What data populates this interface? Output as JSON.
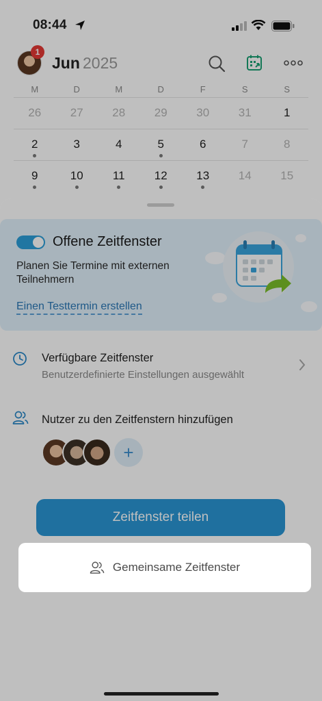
{
  "status_bar": {
    "time": "08:44"
  },
  "calendar": {
    "month": "Jun",
    "year": "2025",
    "notification_count": "1",
    "weekdays": [
      "M",
      "D",
      "M",
      "D",
      "F",
      "S",
      "S"
    ],
    "weeks": [
      [
        {
          "d": "26",
          "m": true,
          "e": false
        },
        {
          "d": "27",
          "m": true,
          "e": false
        },
        {
          "d": "28",
          "m": true,
          "e": false
        },
        {
          "d": "29",
          "m": true,
          "e": false
        },
        {
          "d": "30",
          "m": true,
          "e": false
        },
        {
          "d": "31",
          "m": true,
          "e": false
        },
        {
          "d": "1",
          "m": false,
          "e": false
        }
      ],
      [
        {
          "d": "2",
          "m": false,
          "e": true
        },
        {
          "d": "3",
          "m": false,
          "e": false
        },
        {
          "d": "4",
          "m": false,
          "e": false
        },
        {
          "d": "5",
          "m": false,
          "e": true
        },
        {
          "d": "6",
          "m": false,
          "e": false
        },
        {
          "d": "7",
          "m": true,
          "e": false
        },
        {
          "d": "8",
          "m": true,
          "e": false
        }
      ],
      [
        {
          "d": "9",
          "m": false,
          "e": true
        },
        {
          "d": "10",
          "m": false,
          "e": true
        },
        {
          "d": "11",
          "m": false,
          "e": true
        },
        {
          "d": "12",
          "m": false,
          "e": true
        },
        {
          "d": "13",
          "m": false,
          "e": true
        },
        {
          "d": "14",
          "m": true,
          "e": false
        },
        {
          "d": "15",
          "m": true,
          "e": false
        }
      ]
    ]
  },
  "sheet": {
    "promo": {
      "toggle_on": true,
      "title": "Offene Zeitfenster",
      "description": "Planen Sie Termine mit externen Teilnehmern",
      "link": "Einen Testtermin erstellen"
    },
    "available": {
      "title": "Verfügbare Zeitfenster",
      "subtitle": "Benutzerdefinierte Einstellungen ausgewählt"
    },
    "users": {
      "title": "Nutzer zu den Zeitfenstern hinzufügen",
      "add_symbol": "+"
    },
    "primary_button": "Zeitfenster teilen",
    "secondary_button": "Gemeinsame Zeitfenster"
  },
  "colors": {
    "accent": "#2a96d4",
    "promo_bg": "#e1f1fb",
    "badge": "#e53935"
  }
}
